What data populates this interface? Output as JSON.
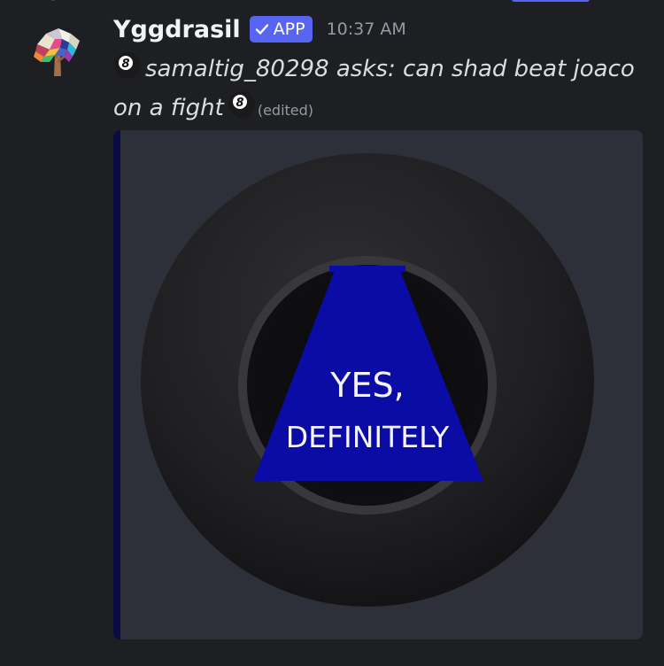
{
  "author": {
    "name": "Yggdrasil",
    "badge": "APP",
    "timestamp": "10:37 AM"
  },
  "message": {
    "text": "samaltig_80298 asks: can shad beat joaco on a fight",
    "edited": "(edited)",
    "emoji": "8ball"
  },
  "embed": {
    "accent_color": "#0a0a45",
    "answer_line1": "YES,",
    "answer_line2": "DEFINITELY",
    "triangle_color": "#0b0ba5"
  },
  "icons": {
    "avatar": "tree-avatar-icon",
    "badge_check": "check-icon",
    "emoji": "8ball-icon"
  }
}
